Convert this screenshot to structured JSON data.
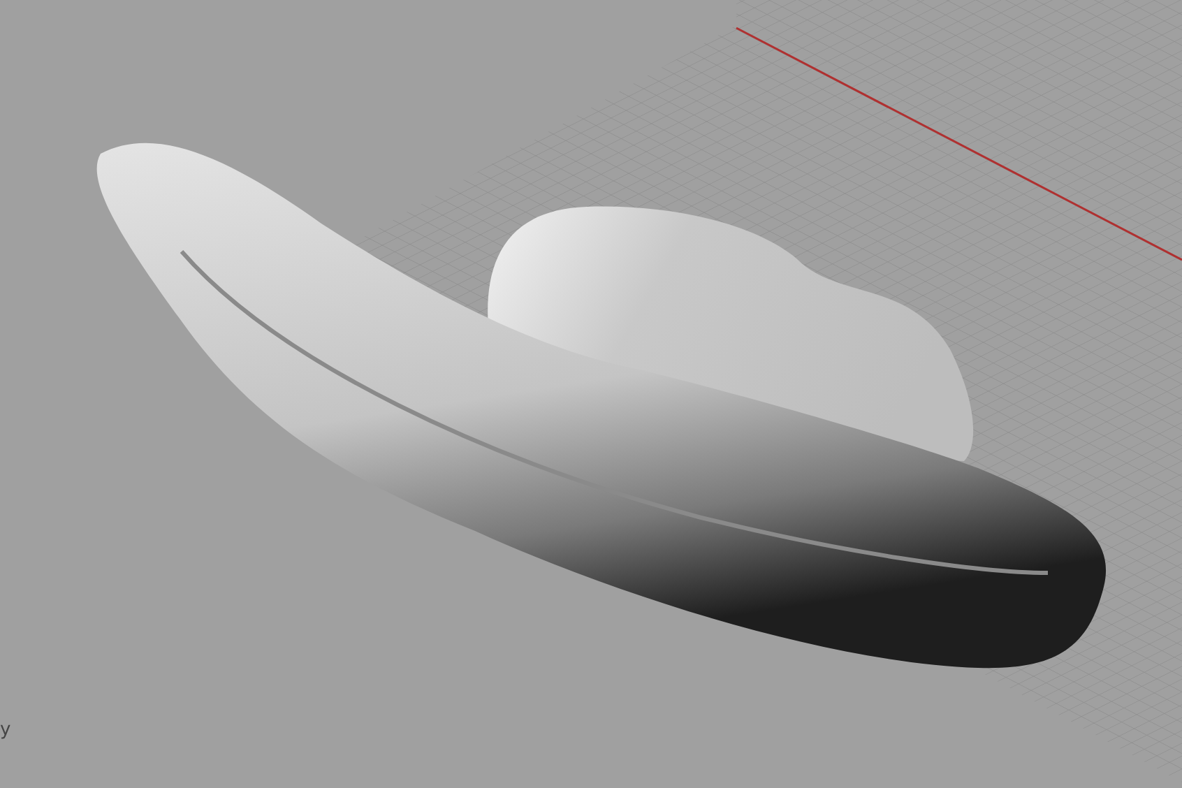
{
  "viewport": {
    "axis_label": "y"
  }
}
